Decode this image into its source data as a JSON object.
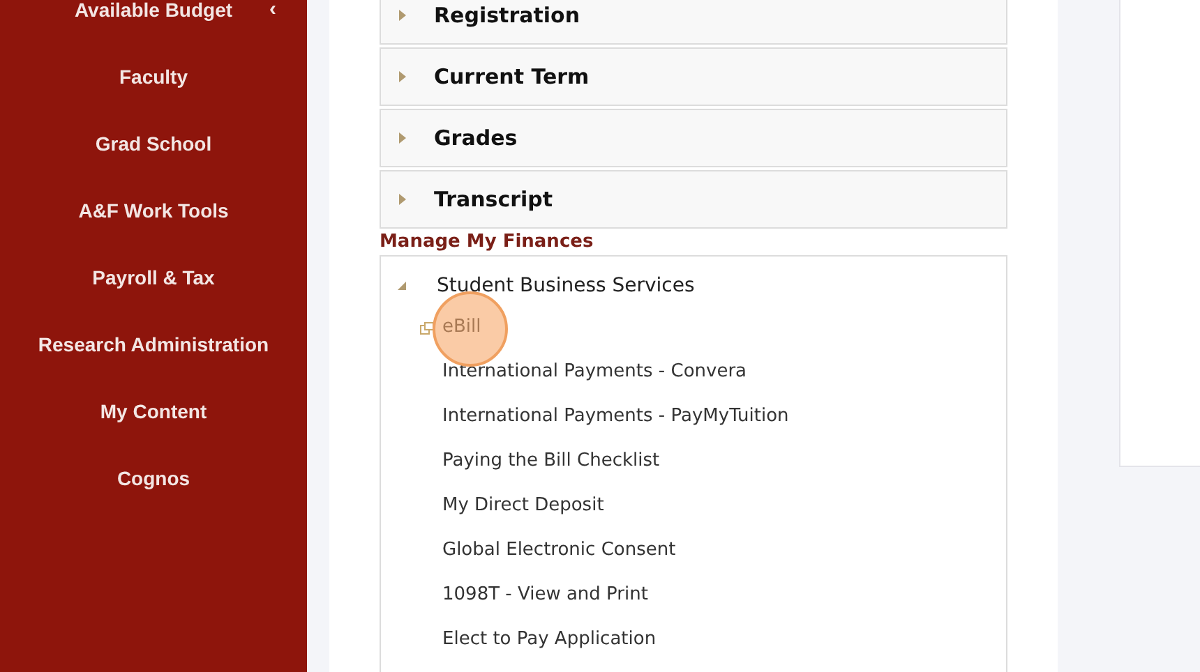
{
  "sidebar": {
    "items": [
      {
        "label": "Available Budget",
        "collapse_glyph": "‹"
      },
      {
        "label": "Faculty"
      },
      {
        "label": "Grad School"
      },
      {
        "label": "A&F Work Tools"
      },
      {
        "label": "Payroll & Tax"
      },
      {
        "label": "Research Administration"
      },
      {
        "label": "My Content"
      },
      {
        "label": "Cognos"
      }
    ]
  },
  "sections": [
    {
      "label": "Registration",
      "expanded": false
    },
    {
      "label": "Current Term",
      "expanded": false
    },
    {
      "label": "Grades",
      "expanded": false
    },
    {
      "label": "Transcript",
      "expanded": false
    }
  ],
  "finances": {
    "heading": "Manage My Finances",
    "group": {
      "label": "Student Business Services",
      "expanded": true,
      "links": [
        {
          "label": "eBill",
          "kind": "external",
          "clicked": true
        },
        {
          "label": "International Payments - Convera",
          "kind": "internal",
          "clicked": false
        },
        {
          "label": "International Payments - PayMyTuition",
          "kind": "internal",
          "clicked": false
        },
        {
          "label": "Paying the Bill Checklist",
          "kind": "internal",
          "clicked": false
        },
        {
          "label": "My Direct Deposit",
          "kind": "internal",
          "clicked": false
        },
        {
          "label": "Global Electronic Consent",
          "kind": "internal",
          "clicked": false
        },
        {
          "label": "1098T - View and Print",
          "kind": "internal",
          "clicked": false
        },
        {
          "label": "Elect to Pay Application",
          "kind": "internal",
          "clicked": false
        }
      ]
    }
  }
}
